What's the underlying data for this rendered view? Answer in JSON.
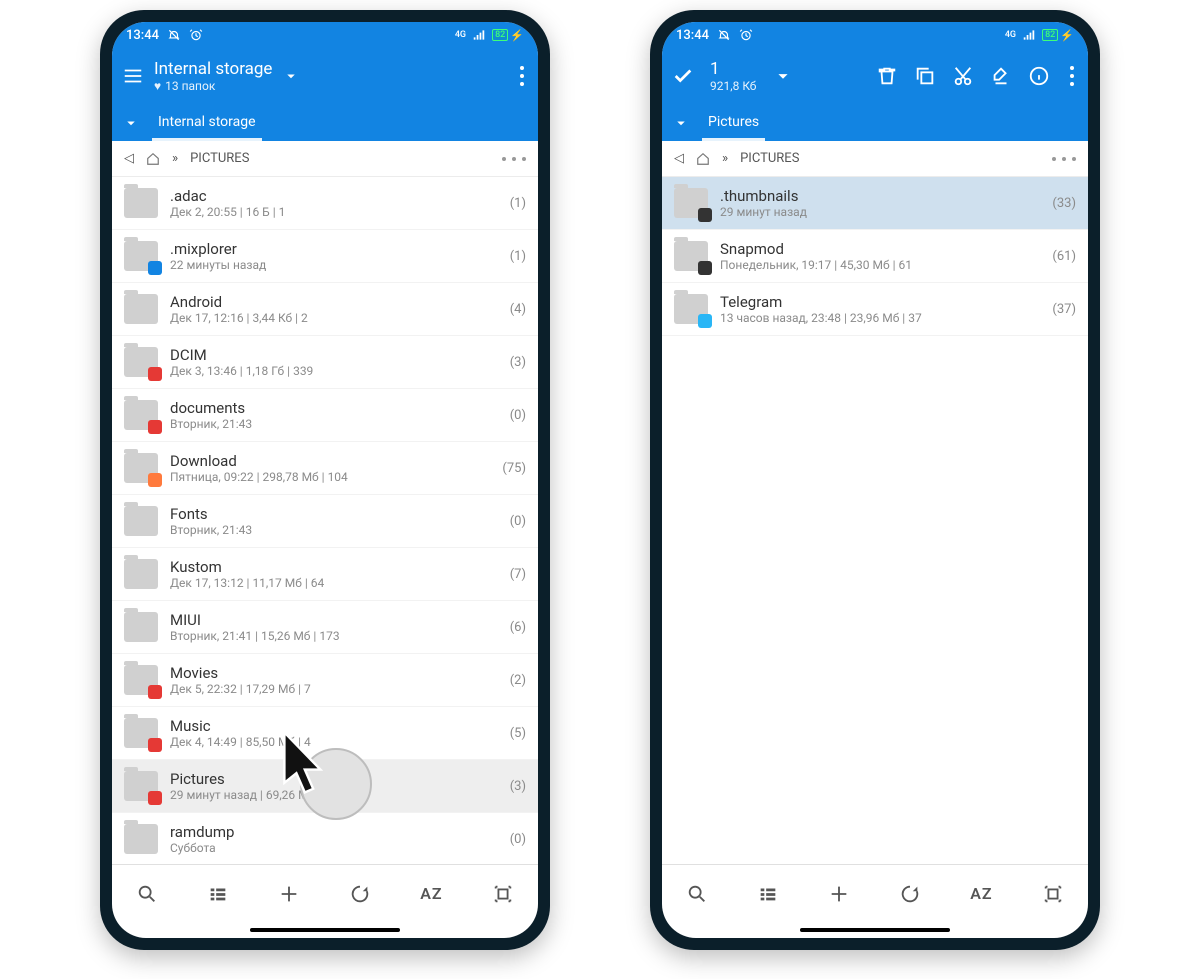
{
  "status": {
    "time": "13:44",
    "net": "4G",
    "battery": "82"
  },
  "left": {
    "title": "Internal storage",
    "subtitle": "13 папок",
    "tab": "Internal storage",
    "crumb": "PICTURES",
    "rows": [
      {
        "name": ".adac",
        "meta": "Дек 2, 20:55 | 16 Б | 1",
        "cnt": "(1)",
        "badge": ""
      },
      {
        "name": ".mixplorer",
        "meta": "22 минуты назад",
        "cnt": "(1)",
        "badge": "b-blue"
      },
      {
        "name": "Android",
        "meta": "Дек 17, 12:16 | 3,44  Кб | 2",
        "cnt": "(4)",
        "badge": ""
      },
      {
        "name": "DCIM",
        "meta": "Дек 3, 13:46 | 1,18 Гб | 339",
        "cnt": "(3)",
        "badge": "b-red"
      },
      {
        "name": "documents",
        "meta": "Вторник, 21:43",
        "cnt": "(0)",
        "badge": "b-red"
      },
      {
        "name": "Download",
        "meta": "Пятница, 09:22 | 298,78 Мб | 104",
        "cnt": "(75)",
        "badge": "b-orange"
      },
      {
        "name": "Fonts",
        "meta": "Вторник, 21:43",
        "cnt": "(0)",
        "badge": ""
      },
      {
        "name": "Kustom",
        "meta": "Дек 17, 13:12 | 11,17 Мб | 64",
        "cnt": "(7)",
        "badge": ""
      },
      {
        "name": "MIUI",
        "meta": "Вторник, 21:41 | 15,26 Мб | 173",
        "cnt": "(6)",
        "badge": ""
      },
      {
        "name": "Movies",
        "meta": "Дек 5, 22:32 | 17,29 Мб | 7",
        "cnt": "(2)",
        "badge": "b-redcam"
      },
      {
        "name": "Music",
        "meta": "Дек 4, 14:49 | 85,50 Мб | 4",
        "cnt": "(5)",
        "badge": "b-red"
      },
      {
        "name": "Pictures",
        "meta": "29 минут назад | 69,26 Мб | 100",
        "cnt": "(3)",
        "badge": "b-red",
        "hover": true
      },
      {
        "name": "ramdump",
        "meta": "Суббота",
        "cnt": "(0)",
        "badge": ""
      }
    ]
  },
  "right": {
    "sel_count": "1",
    "sel_size": "921,8  Кб",
    "tab": "Pictures",
    "crumb": "PICTURES",
    "rows": [
      {
        "name": ".thumbnails",
        "meta": "29 минут назад",
        "cnt": "(33)",
        "badge": "b-dark",
        "selected": true
      },
      {
        "name": "Snapmod",
        "meta": "Понедельник, 19:17 | 45,30 Мб | 61",
        "cnt": "(61)",
        "badge": "b-dark"
      },
      {
        "name": "Telegram",
        "meta": "13 часов назад, 23:48 | 23,96 Мб | 37",
        "cnt": "(37)",
        "badge": "b-cyan"
      }
    ]
  }
}
